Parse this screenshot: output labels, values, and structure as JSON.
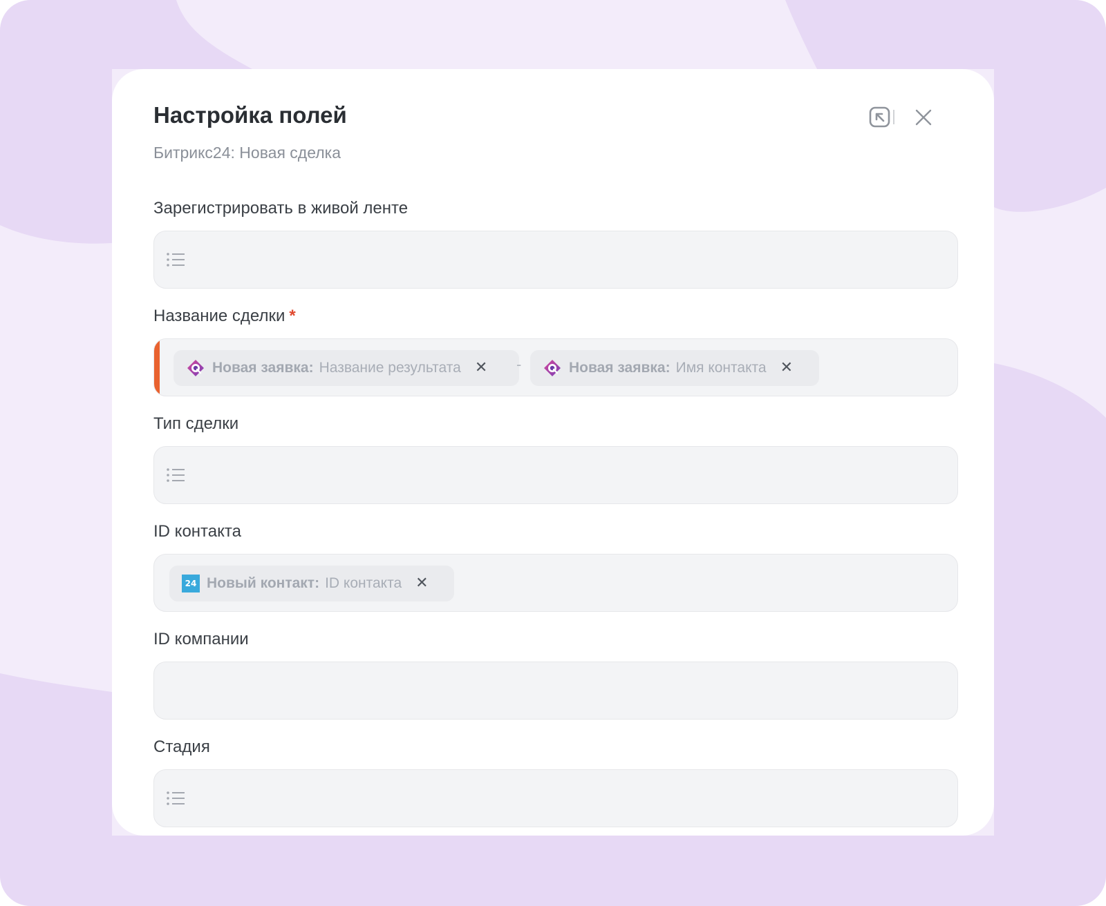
{
  "dialog": {
    "title": "Настройка полей",
    "subtitle": "Битрикс24: Новая сделка",
    "icons": {
      "collapse": "collapse-icon",
      "close": "close-icon"
    }
  },
  "fields": [
    {
      "label": "Зарегистрировать в живой ленте",
      "type": "select"
    },
    {
      "label": "Название сделки",
      "required_mark": "*",
      "type": "tags",
      "error": true,
      "chips": [
        {
          "source": "Новая заявка:",
          "value": "Название результата",
          "remove": "✕",
          "icon": "form-app-icon"
        },
        {
          "source": "Новая заявка:",
          "value": "Имя контакта",
          "remove": "✕",
          "icon": "form-app-icon"
        }
      ],
      "separator": "-"
    },
    {
      "label": "Тип сделки",
      "type": "select"
    },
    {
      "label": "ID контакта",
      "type": "tags",
      "chips": [
        {
          "source": "Новый контакт:",
          "value": "ID контакта",
          "remove": "✕",
          "icon_text": "24",
          "icon": "bitrix24-icon"
        }
      ]
    },
    {
      "label": "ID компании",
      "type": "text",
      "value": ""
    },
    {
      "label": "Стадия",
      "type": "select"
    }
  ],
  "colors": {
    "background": "#f3ecfa",
    "blob": "#e7d9f5",
    "error": "#e9622f",
    "required": "#e0492f",
    "bitrix_blue": "#39a9dc"
  }
}
